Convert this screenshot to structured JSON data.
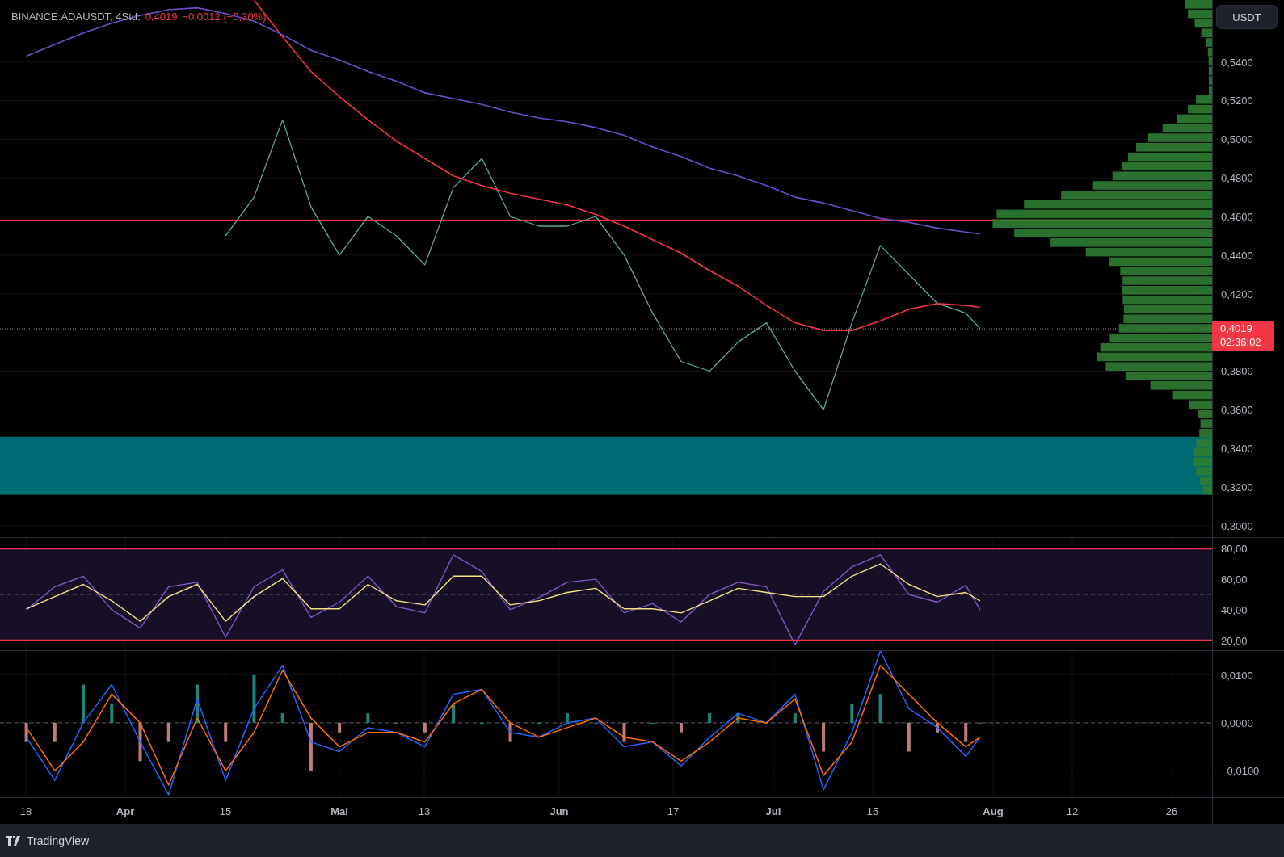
{
  "legend": {
    "symbol": "BINANCE:ADAUSDT, 4Std.",
    "last": "0,4019",
    "change": "−0,0012 (−0,30%)"
  },
  "currency_button": "USDT",
  "price_axis": [
    "0,5400",
    "0,5200",
    "0,5000",
    "0,4800",
    "0,4600",
    "0,4400",
    "0,4200",
    "0,3800",
    "0,3600",
    "0,3400",
    "0,3200",
    "0,3000"
  ],
  "price_tag": {
    "price": "0,4019",
    "countdown": "02:36:02"
  },
  "rsi_axis": [
    "80,00",
    "60,00",
    "40,00",
    "20,00"
  ],
  "macd_axis": [
    "0,0100",
    "0,0000",
    "−0,0100"
  ],
  "time_axis": [
    {
      "label": "18",
      "kind": "day"
    },
    {
      "label": "Apr",
      "kind": "month"
    },
    {
      "label": "15",
      "kind": "day"
    },
    {
      "label": "Mai",
      "kind": "month"
    },
    {
      "label": "13",
      "kind": "day"
    },
    {
      "label": "Jun",
      "kind": "month"
    },
    {
      "label": "17",
      "kind": "day"
    },
    {
      "label": "Jul",
      "kind": "month"
    },
    {
      "label": "15",
      "kind": "day"
    },
    {
      "label": "Aug",
      "kind": "month"
    },
    {
      "label": "12",
      "kind": "day"
    },
    {
      "label": "26",
      "kind": "day"
    }
  ],
  "footer": {
    "brand": "TradingView"
  }
}
